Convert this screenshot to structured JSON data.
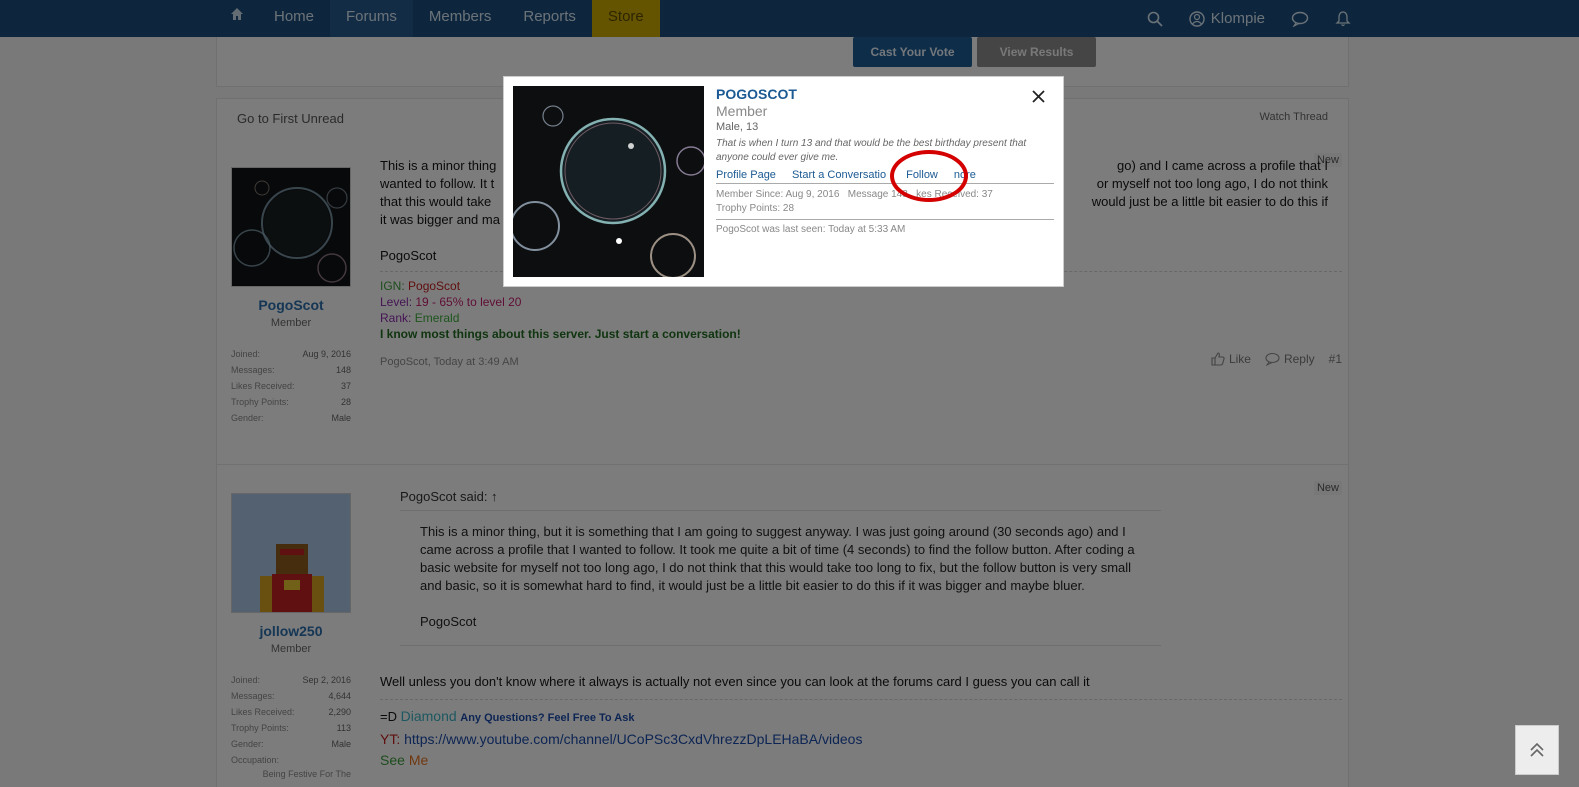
{
  "nav": {
    "home": "Home",
    "forums": "Forums",
    "members": "Members",
    "reports": "Reports",
    "store": "Store",
    "username": "Klompie"
  },
  "poll": {
    "vote": "Cast Your Vote",
    "results": "View Results"
  },
  "thread": {
    "first_unread": "Go to First Unread",
    "watch": "Watch Thread"
  },
  "post1": {
    "new": "New",
    "user": {
      "name": "PogoScot",
      "title": "Member",
      "stats": [
        {
          "label": "Joined:",
          "value": "Aug 9, 2016"
        },
        {
          "label": "Messages:",
          "value": "148"
        },
        {
          "label": "Likes Received:",
          "value": "37"
        },
        {
          "label": "Trophy Points:",
          "value": "28"
        },
        {
          "label": "Gender:",
          "value": "Male"
        }
      ]
    },
    "text_left": "This is a minor thing",
    "text_right": "go) and I came across a profile that I",
    "line2_left": "wanted to follow. It t",
    "line2_right": "or myself not too long ago, I do not think",
    "line3_left": "that this would take",
    "line3_right": "would just be a little bit easier to do this if",
    "line4_left": "it was bigger and ma",
    "sign": "PogoScot",
    "sig": {
      "ign_label": "IGN:",
      "ign_value": "PogoScot",
      "level_label": "Level:",
      "level_value": "19 - 65% to level 20",
      "rank_label": "Rank:",
      "rank_value": "Emerald",
      "tagline": "I know most things about this server. Just start a conversation!"
    },
    "meta": "PogoScot, Today at 3:49 AM",
    "like": "Like",
    "reply": "Reply",
    "num": "#1"
  },
  "post2": {
    "new": "New",
    "user": {
      "name": "jollow250",
      "title": "Member",
      "stats": [
        {
          "label": "Joined:",
          "value": "Sep 2, 2016"
        },
        {
          "label": "Messages:",
          "value": "4,644"
        },
        {
          "label": "Likes Received:",
          "value": "2,290"
        },
        {
          "label": "Trophy Points:",
          "value": "113"
        },
        {
          "label": "Gender:",
          "value": "Male"
        },
        {
          "label": "Occupation:",
          "value": ""
        }
      ],
      "occupation_value": "Being Festive For The"
    },
    "quote_head": "PogoScot said: ↑",
    "quote_body": "This is a minor thing, but it is something that I am going to suggest anyway. I was just going around (30 seconds ago) and I came across a profile that I wanted to follow. It took me quite a bit of time (4 seconds) to find the follow button. After coding a basic website for myself not too long ago, I do not think that this would take too long to fix, but the follow button is very small and basic, so it is somewhat hard to find, it would just be a little bit easier to do this if it was bigger and maybe bluer.",
    "quote_sign": "PogoScot",
    "reply_text": "Well unless you don't know where it always is actually not even since you can look at the forums card I guess you can call it",
    "sig_prefix": "=D",
    "sig_diamond": "Diamond",
    "sig_questions": "Any Questions? Feel Free To Ask",
    "sig_yt_label": "YT:",
    "sig_yt_url": "https://www.youtube.com/channel/UCoPSc3CxdVhrezzDpLEHaBA/videos",
    "sig_see": "See",
    "sig_me": "Me"
  },
  "card": {
    "name": "POGOSCOT",
    "role": "Member",
    "gender": "Male, 13",
    "bio": "That is when I turn 13 and that would be the best birthday present that anyone could ever give me.",
    "links": {
      "profile": "Profile Page",
      "conversation": "Start a Conversatio",
      "follow": "Follow",
      "ignore": "nore"
    },
    "member_since": "Member Since: Aug 9, 2016",
    "messages": "Message",
    "messages_value": "148",
    "likes": "kes Received: 37",
    "trophy": "Trophy Points: 28",
    "last_seen": "PogoScot was last seen: Today at 5:33 AM"
  },
  "colors": {
    "nav_bg": "#1b4d7a",
    "store_bg": "#c9a900",
    "link": "#1b5a93",
    "highlight_circle": "#d40000"
  }
}
